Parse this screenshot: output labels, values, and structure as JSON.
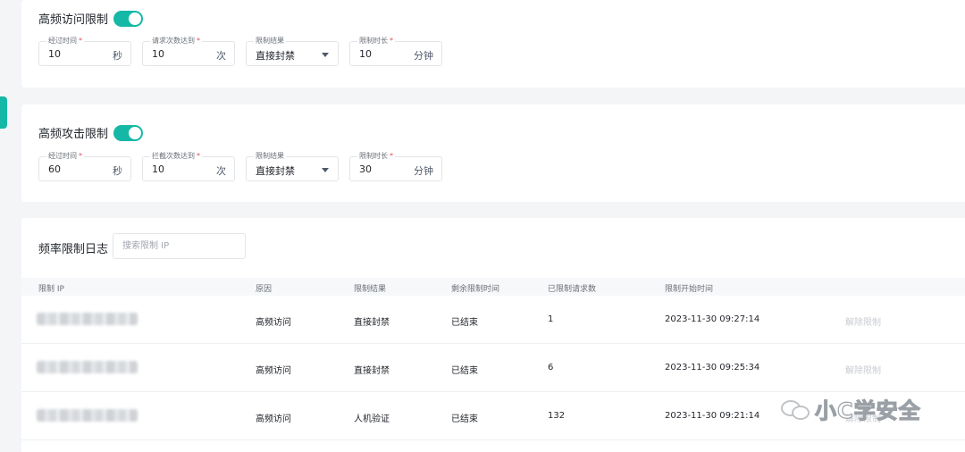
{
  "high_freq_access": {
    "title": "高频访问限制",
    "enabled": true,
    "fields": [
      {
        "label": "经过时间",
        "required": true,
        "value": "10",
        "unit": "秒"
      },
      {
        "label": "请求次数达到",
        "required": true,
        "value": "10",
        "unit": "次"
      },
      {
        "label": "限制结果",
        "required": false,
        "value": "直接封禁",
        "dropdown": true
      },
      {
        "label": "限制时长",
        "required": true,
        "value": "10",
        "unit": "分钟"
      }
    ]
  },
  "high_freq_attack": {
    "title": "高频攻击限制",
    "enabled": true,
    "fields": [
      {
        "label": "经过时间",
        "required": true,
        "value": "60",
        "unit": "秒"
      },
      {
        "label": "拦截次数达到",
        "required": true,
        "value": "10",
        "unit": "次"
      },
      {
        "label": "限制结果",
        "required": false,
        "value": "直接封禁",
        "dropdown": true
      },
      {
        "label": "限制时长",
        "required": true,
        "value": "30",
        "unit": "分钟"
      }
    ]
  },
  "log": {
    "title": "频率限制日志",
    "search_placeholder": "搜索限制 IP",
    "columns": [
      "限制 IP",
      "原因",
      "限制结果",
      "剩余限制时间",
      "已限制请求数",
      "限制开始时间"
    ],
    "rows": [
      {
        "reason": "高频访问",
        "result": "直接封禁",
        "remaining": "已结束",
        "count": "1",
        "start": "2023-11-30 09:27:14",
        "action": "解除限制"
      },
      {
        "reason": "高频访问",
        "result": "直接封禁",
        "remaining": "已结束",
        "count": "6",
        "start": "2023-11-30 09:25:34",
        "action": "解除限制"
      },
      {
        "reason": "高频访问",
        "result": "人机验证",
        "remaining": "已结束",
        "count": "132",
        "start": "2023-11-30 09:21:14",
        "action": "解除限制"
      }
    ]
  },
  "watermark": {
    "text": "小C学安全"
  },
  "colors": {
    "accent": "#15b8a6",
    "required": "#e34d59"
  }
}
